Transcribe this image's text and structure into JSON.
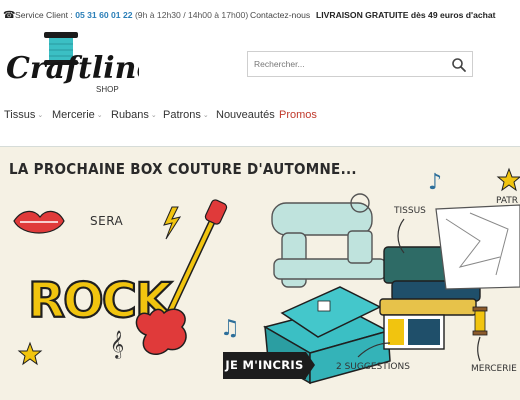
{
  "topbar": {
    "phone_icon": "phone-icon",
    "service_label": "Service Client :",
    "phone_number": "05 31 60 01 22",
    "hours": "(9h à 12h30 / 14h00 à 17h00)",
    "contact": "Contactez-nous",
    "shipping": "LIVRAISON GRATUITE dès 49 euros d'achat"
  },
  "logo": {
    "name": "Craftline",
    "sub": "SHOP"
  },
  "search": {
    "placeholder": "Rechercher...",
    "icon": "search-icon"
  },
  "nav": {
    "items": [
      {
        "label": "Tissus",
        "has_menu": true
      },
      {
        "label": "Mercerie",
        "has_menu": true
      },
      {
        "label": "Rubans",
        "has_menu": true
      },
      {
        "label": "Patrons",
        "has_menu": true
      },
      {
        "label": "Nouveautés",
        "has_menu": false
      },
      {
        "label": "Promos",
        "has_menu": false
      }
    ]
  },
  "banner": {
    "headline": "LA PROCHAINE BOX COUTURE D'AUTOMNE...",
    "sera": "SERA",
    "rock": "ROCK",
    "cta": "JE M'INCRIS",
    "tissus": "TISSUS",
    "patrons": "PATR",
    "suggestions": "2 SUGGESTIONS",
    "mercerie": "MERCERIE"
  },
  "colors": {
    "accent_blue": "#2b7fb8",
    "promo_red": "#c0392b",
    "teal": "#3bbfc4",
    "banner_bg": "#f5f1e4"
  }
}
